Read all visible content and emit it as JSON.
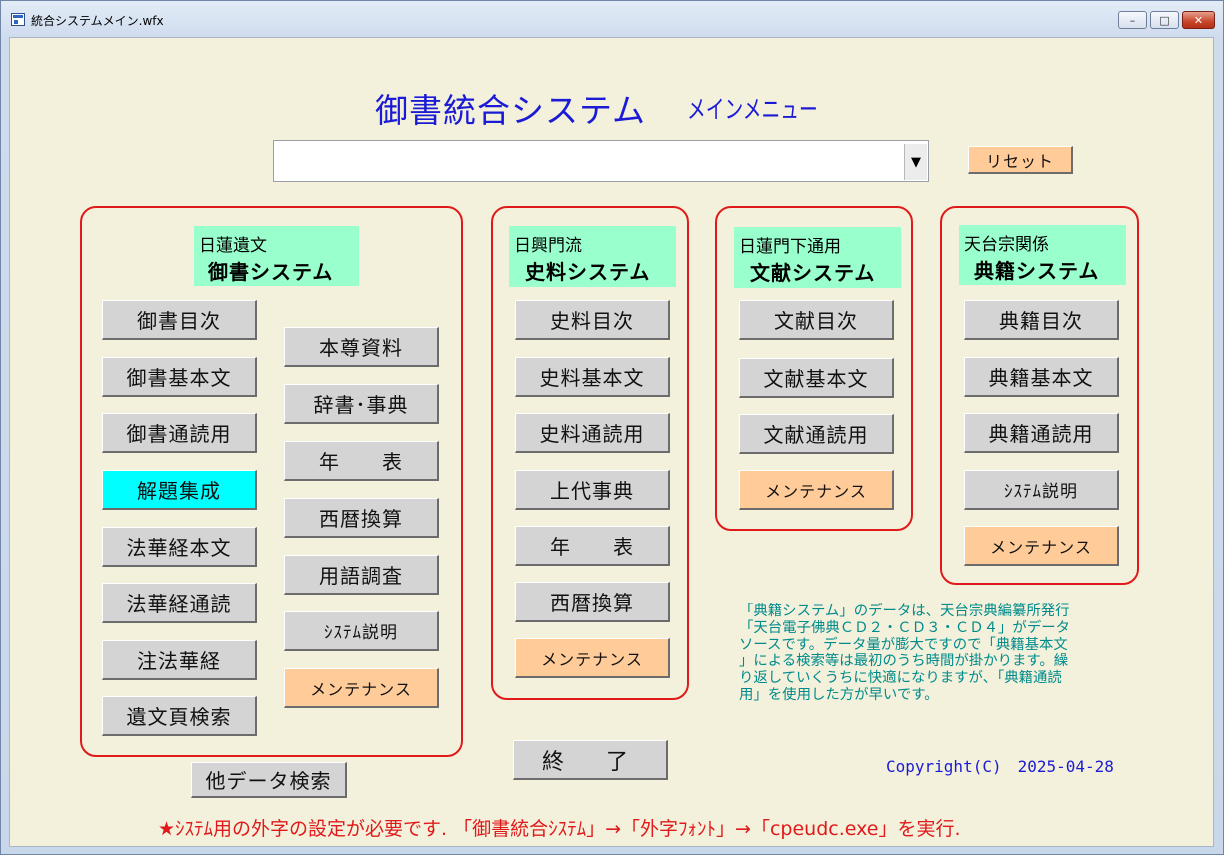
{
  "window": {
    "title": "統合システムメイン.wfx",
    "minimize": "–",
    "maximize": "□",
    "close": "✕"
  },
  "header": {
    "title": "御書統合システム",
    "subtitle": "メインメニュー"
  },
  "search": {
    "value": "",
    "dropdown_icon": "▼",
    "reset_label": "リセット"
  },
  "panels": {
    "gosho": {
      "line1": "日蓮遺文",
      "line2": "御書システム",
      "buttons": [
        "御書目次",
        "御書基本文",
        "御書通読用",
        "解題集成",
        "法華経本文",
        "法華経通読",
        "注法華経",
        "遺文頁検索"
      ],
      "buttons_right": [
        "本尊資料",
        "辞書･事典",
        "年　　表",
        "西暦換算",
        "用語調査",
        "ｼｽﾃﾑ説明",
        "メンテナンス"
      ]
    },
    "shiryo": {
      "line1": "日興門流",
      "line2": "史料システム",
      "buttons": [
        "史料目次",
        "史料基本文",
        "史料通読用",
        "上代事典",
        "年　　表",
        "西暦換算",
        "メンテナンス"
      ]
    },
    "bunken": {
      "line1": "日蓮門下通用",
      "line2": "文献システム",
      "buttons": [
        "文献目次",
        "文献基本文",
        "文献通読用",
        "メンテナンス"
      ]
    },
    "tenseki": {
      "line1": "天台宗関係",
      "line2": "典籍システム",
      "buttons": [
        "典籍目次",
        "典籍基本文",
        "典籍通読用",
        "ｼｽﾃﾑ説明",
        "メンテナンス"
      ]
    }
  },
  "notice": {
    "lines": [
      "「典籍システム」のデータは、天台宗典編纂所発行",
      "「天台電子佛典ＣＤ２・ＣＤ３・ＣＤ４」がデータ",
      "ソースです。データ量が膨大ですので「典籍基本文",
      "」による検索等は最初のうち時間が掛かります。繰",
      "り返していくうちに快適になりますが、「典籍通読",
      "用」を使用した方が早いです。"
    ]
  },
  "footer": {
    "exit_label": "終　了",
    "other_search_label": "他データ検索",
    "copyright": "Copyright(C)　2025-04-28",
    "note": "★ｼｽﾃﾑ用の外字の設定が必要です. 「御書統合ｼｽﾃﾑ」→「外字ﾌｫﾝﾄ」→「cpeudc.exe」を実行."
  },
  "colors": {
    "background": "#f3f1dc",
    "title": "#1b1bd6",
    "panel_border": "#e01a1a",
    "header_fill": "#99ffcc",
    "button_gray": "#d4d4d4",
    "button_peach": "#ffcc99",
    "button_cyan": "#00ffff",
    "notice_text": "#008b8b"
  }
}
